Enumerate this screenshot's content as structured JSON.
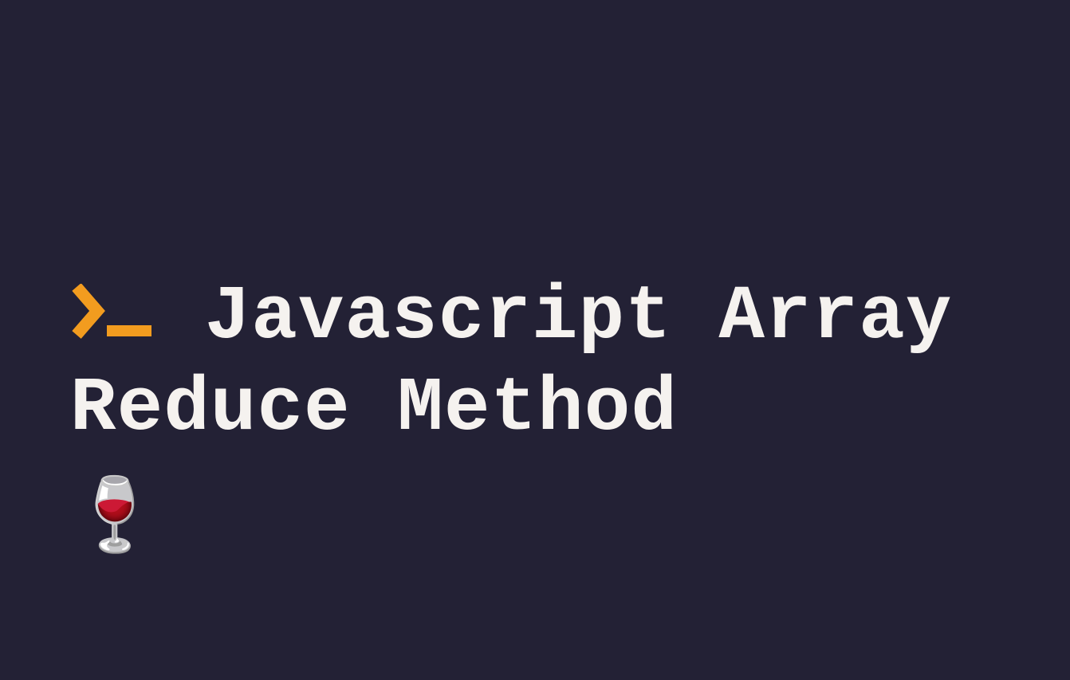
{
  "slide": {
    "title": "Javascript Array Reduce Method",
    "emoji": "🍷",
    "accent_color": "#f29c1f",
    "text_color": "#f5f2ef",
    "background_color": "#232135"
  }
}
